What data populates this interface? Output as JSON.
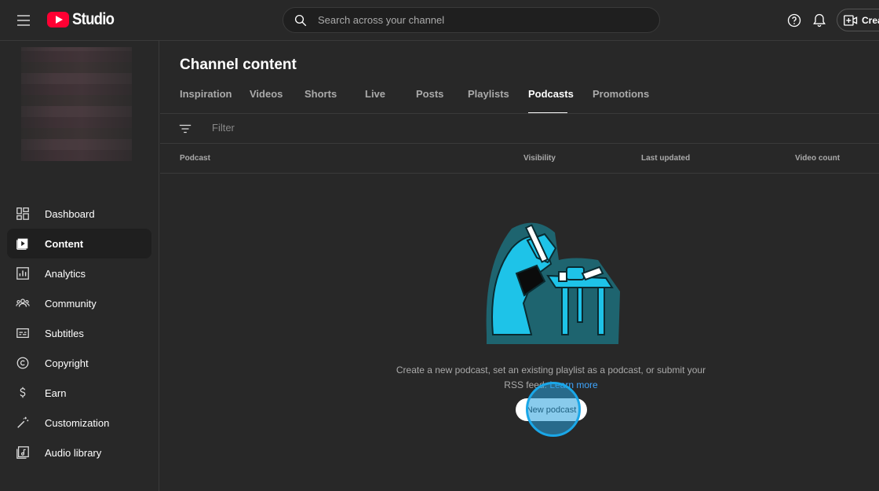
{
  "app": {
    "logo_text": "Studio",
    "search_placeholder": "Search across your channel",
    "create_label": "Crea"
  },
  "sidebar": {
    "items": [
      {
        "label": "Dashboard",
        "icon": "dashboard-icon"
      },
      {
        "label": "Content",
        "icon": "content-icon",
        "active": true
      },
      {
        "label": "Analytics",
        "icon": "analytics-icon"
      },
      {
        "label": "Community",
        "icon": "community-icon"
      },
      {
        "label": "Subtitles",
        "icon": "subtitles-icon"
      },
      {
        "label": "Copyright",
        "icon": "copyright-icon"
      },
      {
        "label": "Earn",
        "icon": "earn-icon"
      },
      {
        "label": "Customization",
        "icon": "customization-icon"
      },
      {
        "label": "Audio library",
        "icon": "audio-library-icon"
      }
    ]
  },
  "main": {
    "title": "Channel content",
    "tabs": [
      {
        "label": "Inspiration"
      },
      {
        "label": "Videos"
      },
      {
        "label": "Shorts"
      },
      {
        "label": "Live"
      },
      {
        "label": "Posts"
      },
      {
        "label": "Playlists"
      },
      {
        "label": "Podcasts",
        "active": true
      },
      {
        "label": "Promotions"
      }
    ],
    "filter_placeholder": "Filter",
    "columns": {
      "podcast": "Podcast",
      "visibility": "Visibility",
      "last_updated": "Last updated",
      "video_count": "Video count"
    },
    "empty": {
      "text": "Create a new podcast, set an existing playlist as a podcast, or submit your RSS feed.",
      "link": "Learn more",
      "button": "New podcast"
    }
  },
  "colors": {
    "background": "#282828",
    "accent_link": "#3ea6ff",
    "brand_red": "#ff0033",
    "illustration_cyan": "#1ec3e8"
  }
}
